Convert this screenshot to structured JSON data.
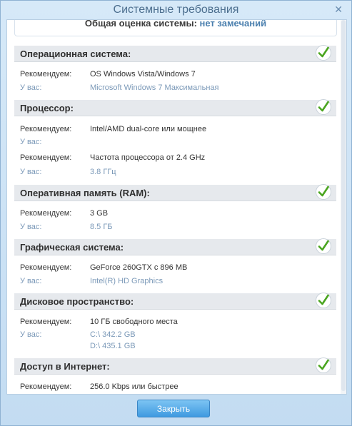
{
  "window": {
    "title": "Системные требования",
    "close_glyph": "✕"
  },
  "summary": {
    "label": "Общая оценка системы:",
    "value": "нет замечаний"
  },
  "sections": [
    {
      "title": "Операционная система:",
      "status": "ok",
      "rows": [
        {
          "key": "Рекомендуем:",
          "value": "OS Windows Vista/Windows 7"
        },
        {
          "key": "У вас:",
          "value": "Microsoft Windows 7 Максимальная"
        }
      ]
    },
    {
      "title": "Процессор:",
      "status": "ok",
      "rows": [
        {
          "key": "Рекомендуем:",
          "value": "Intel/AMD dual-core или мощнее"
        },
        {
          "key": "У вас:",
          "value": ""
        },
        {
          "key": "Рекомендуем:",
          "value": "Частота процессора от 2.4 GHz"
        },
        {
          "key": "У вас:",
          "value": "3.8 ГГц"
        }
      ]
    },
    {
      "title": "Оперативная память (RAM):",
      "status": "ok",
      "rows": [
        {
          "key": "Рекомендуем:",
          "value": "3 GB"
        },
        {
          "key": "У вас:",
          "value": "8.5 ГБ"
        }
      ]
    },
    {
      "title": "Графическая система:",
      "status": "ok",
      "rows": [
        {
          "key": "Рекомендуем:",
          "value": "GeForce 260GTX с 896 MB"
        },
        {
          "key": "У вас:",
          "value": "Intel(R) HD Graphics"
        }
      ]
    },
    {
      "title": "Дисковое пространство:",
      "status": "ok",
      "rows": [
        {
          "key": "Рекомендуем:",
          "value": "10 ГБ свободного места"
        },
        {
          "key": "У вас:",
          "value": "C:\\ 342.2 GB"
        },
        {
          "key": "",
          "value": "D:\\ 435.1 GB"
        }
      ]
    },
    {
      "title": "Доступ в Интернет:",
      "status": "ok",
      "rows": [
        {
          "key": "Рекомендуем:",
          "value": "256.0 Kbps или быстрее"
        }
      ]
    }
  ],
  "footer": {
    "close_button": "Закрыть"
  },
  "colors": {
    "accent": "#3f9ae0",
    "check": "#4aa51f",
    "value_muted": "#7b99b8"
  },
  "icons": {
    "check": "checkmark-icon",
    "close": "close-icon"
  }
}
